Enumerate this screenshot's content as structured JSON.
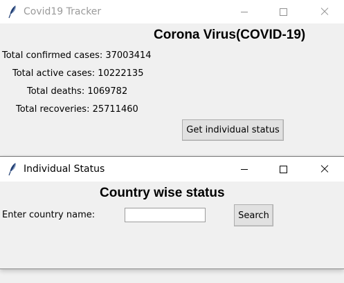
{
  "main_window": {
    "title": "Covid19 Tracker",
    "heading": "Corona Virus(COVID-19)",
    "stats": [
      {
        "label": "Total confirmed cases: 37003414"
      },
      {
        "label": "Total active cases: 10222135"
      },
      {
        "label": "Total deaths: 1069782"
      },
      {
        "label": "Total recoveries: 25711460"
      }
    ],
    "status_button": "Get individual status",
    "active": false
  },
  "individual_window": {
    "title": "Individual Status",
    "heading": "Country wise status",
    "country_label": "Enter country name:",
    "country_input_value": "",
    "search_button": "Search",
    "active": true
  },
  "icons": {
    "app": "feather-icon",
    "minimize": "minimize-icon",
    "maximize": "maximize-icon",
    "close": "close-icon"
  },
  "colors": {
    "titlebar": "#ffffff",
    "window_bg": "#f0f0f0",
    "inactive_title": "#9a9a9a",
    "button_bg": "#e1e1e1",
    "feather": "#1f3d73"
  }
}
